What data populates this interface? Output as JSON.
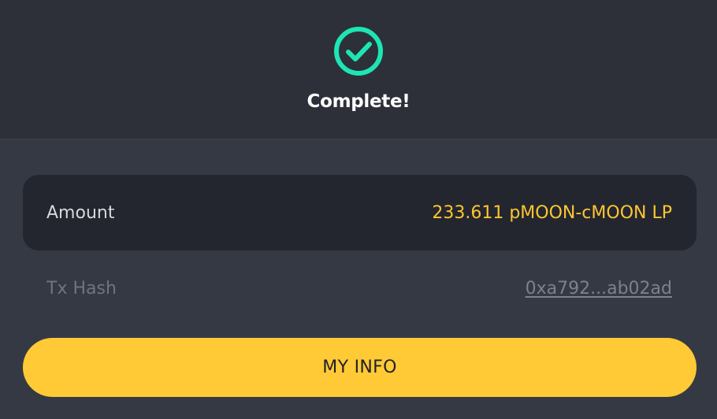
{
  "header": {
    "status_icon": "check-circle-icon",
    "title": "Complete!"
  },
  "details": {
    "amount_label": "Amount",
    "amount_value": "233.611 pMOON-cMOON LP",
    "tx_label": "Tx Hash",
    "tx_hash": "0xa792...ab02ad"
  },
  "actions": {
    "my_info_label": "MY INFO"
  },
  "colors": {
    "success": "#1de5b4",
    "accent": "#ffca35",
    "amount_text": "#ffc632",
    "header_bg": "#2d3039",
    "body_bg": "#353944",
    "card_bg": "#23262e"
  }
}
